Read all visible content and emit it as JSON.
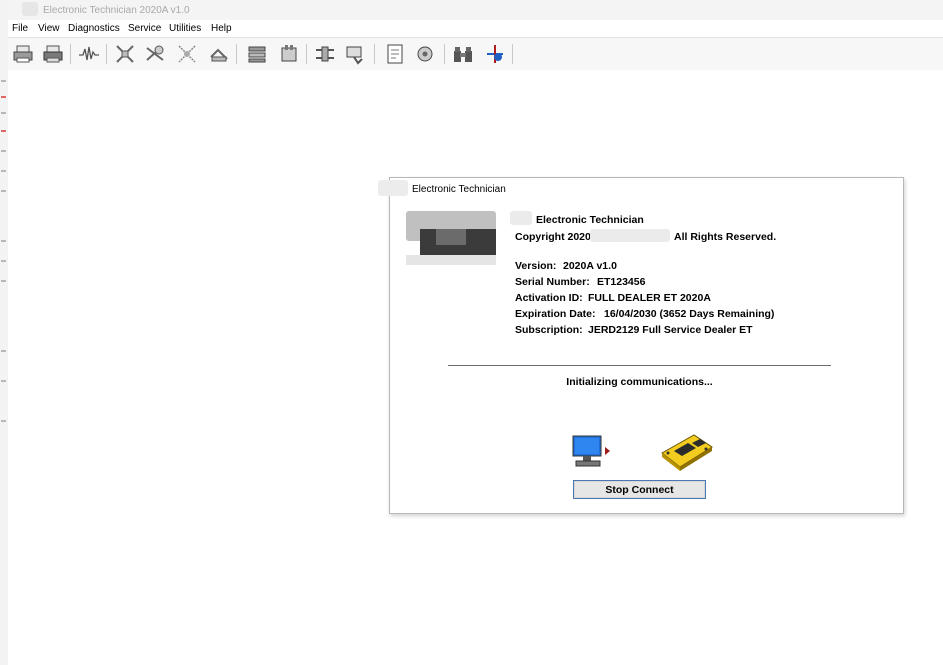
{
  "window": {
    "title": "Electronic Technician 2020A v1.0"
  },
  "menu": [
    "File",
    "View",
    "Diagnostics",
    "Service",
    "Utilities",
    "Help"
  ],
  "toolbar": {
    "icons": [
      "print-icon",
      "print-preview-icon",
      "waveform-icon",
      "diagnostic-tests-icon",
      "calibration-icon",
      "service-procedure-icon",
      "clear-events-icon",
      "status-groups-icon",
      "configuration-icon",
      "data-link-icon",
      "ecm-summary-icon",
      "report-icon",
      "settings-icon",
      "binoculars-icon",
      "connect-icon"
    ]
  },
  "dialog": {
    "title": "Electronic Technician",
    "product_name": "Electronic Technician",
    "copyright_prefix": "Copyright 2020",
    "copyright_suffix": "All Rights Reserved.",
    "version_label": "Version:",
    "version_value": "2020A v1.0",
    "serial_label": "Serial Number:",
    "serial_value": "ET123456",
    "activation_label": "Activation ID:",
    "activation_value": "FULL DEALER ET 2020A",
    "expiration_label": "Expiration Date:",
    "expiration_value": "16/04/2030 (3652 Days Remaining)",
    "subscription_label": "Subscription:",
    "subscription_value": "JERD2129 Full Service Dealer ET",
    "status": "Initializing communications...",
    "stop_button": "Stop Connect"
  },
  "colors": {
    "button_border": "#4a78b0",
    "ecm_yellow": "#f2cc1e",
    "pc_blue": "#1f6fd6",
    "arrow_red": "#9b1b1b"
  }
}
